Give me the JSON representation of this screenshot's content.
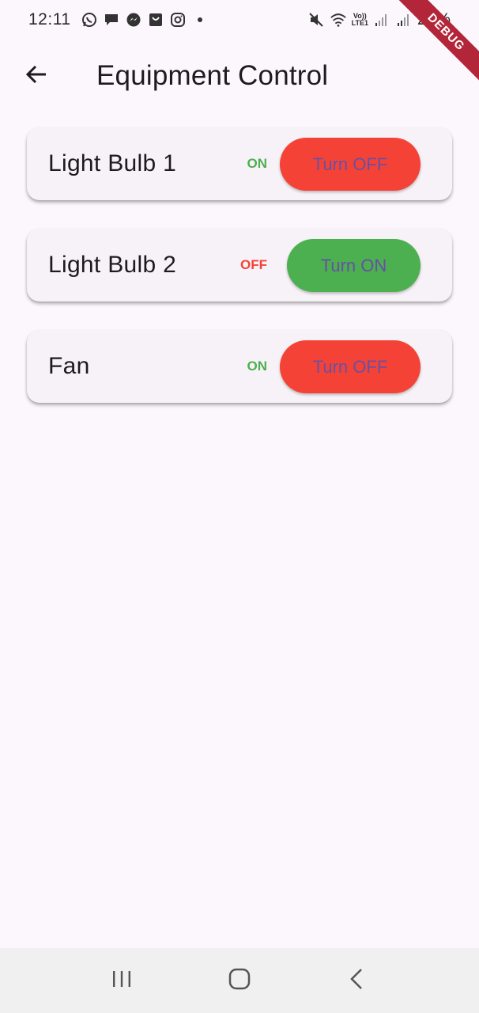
{
  "status_bar": {
    "time": "12:11",
    "left_icons": [
      "whatsapp-icon",
      "message-icon",
      "messenger-icon",
      "inbox-icon",
      "instagram-icon",
      "dot-icon"
    ],
    "volte_label": "Vo))",
    "lte_label": "LTE1",
    "battery": "29%"
  },
  "debug_banner": {
    "label": "DEBUG"
  },
  "app_bar": {
    "back_icon": "arrow-left-icon",
    "title": "Equipment Control"
  },
  "devices": [
    {
      "name": "Light Bulb 1",
      "status": "ON",
      "button_label": "Turn OFF"
    },
    {
      "name": "Light Bulb 2",
      "status": "OFF",
      "button_label": "Turn ON"
    },
    {
      "name": "Fan",
      "status": "ON",
      "button_label": "Turn OFF"
    }
  ],
  "colors": {
    "background": "#fcf7fc",
    "card": "#f7f2f7",
    "on_green": "#4caf50",
    "off_red": "#f44336",
    "button_text": "#6750a4"
  },
  "nav_bar": {
    "items": [
      "recent-apps-icon",
      "home-icon",
      "back-icon"
    ]
  }
}
